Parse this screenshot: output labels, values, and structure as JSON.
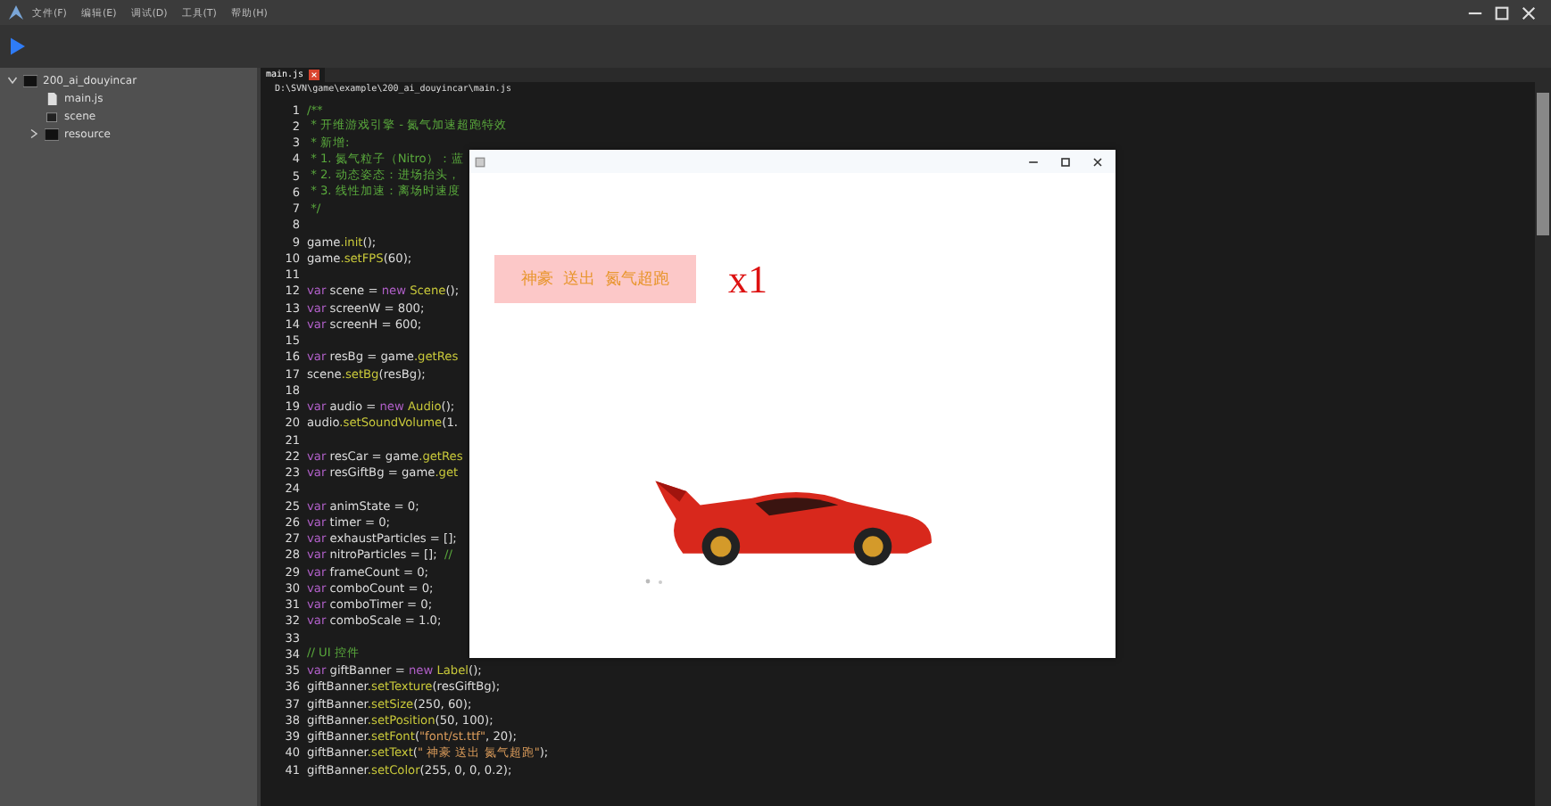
{
  "menu": [
    "文件(F)",
    "编辑(E)",
    "调试(D)",
    "工具(T)",
    "帮助(H)"
  ],
  "project_tree": [
    {
      "label": "200_ai_douyincar",
      "kind": "folder",
      "expanded": true,
      "children": [
        {
          "label": "main.js",
          "kind": "file"
        },
        {
          "label": "scene",
          "kind": "scene"
        },
        {
          "label": "resource",
          "kind": "folder",
          "expanded": false
        }
      ]
    }
  ],
  "editor": {
    "tab": {
      "label": "main.js",
      "selected": true
    },
    "path": "D:\\SVN\\game\\example\\200_ai_douyincar\\main.js",
    "lines": [
      {
        "number": "1",
        "text": "/**"
      },
      {
        "number": "2",
        "text": " * 开维游戏引擎 - 氮气加速超跑特效"
      },
      {
        "number": "3",
        "text": " * 新增:"
      },
      {
        "number": "4",
        "text": " * 1. 氮气粒子（Nitro）：蓝"
      },
      {
        "number": "5",
        "text": " * 2. 动态姿态：进场抬头，"
      },
      {
        "number": "6",
        "text": " * 3. 线性加速：离场时速度"
      },
      {
        "number": "7",
        "text": " */"
      },
      {
        "number": "8"
      },
      {
        "number": "9",
        "text": "game.init();"
      },
      {
        "number": "10",
        "text": "game.setFPS(60);"
      },
      {
        "number": "11"
      },
      {
        "number": "12",
        "text": "var scene = new Scene();"
      },
      {
        "number": "13",
        "text": "var screenW = 800;"
      },
      {
        "number": "14",
        "text": "var screenH = 600;"
      },
      {
        "number": "15"
      },
      {
        "number": "16",
        "text": "var resBg = game.getRes"
      },
      {
        "number": "17",
        "text": "scene.setBg(resBg);"
      },
      {
        "number": "18"
      },
      {
        "number": "19",
        "text": "var audio = new Audio();"
      },
      {
        "number": "20",
        "text": "audio.setSoundVolume(1."
      },
      {
        "number": "21"
      },
      {
        "number": "22",
        "text": "var resCar = game.getRes"
      },
      {
        "number": "23",
        "text": "var resGiftBg = game.get"
      },
      {
        "number": "24"
      },
      {
        "number": "25",
        "text": "var animState = 0;"
      },
      {
        "number": "26",
        "text": "var timer = 0;"
      },
      {
        "number": "27",
        "text": "var exhaustParticles = [];"
      },
      {
        "number": "28",
        "text": "var nitroParticles = [];  //"
      },
      {
        "number": "29",
        "text": "var frameCount = 0;"
      },
      {
        "number": "30",
        "text": "var comboCount = 0;"
      },
      {
        "number": "31",
        "text": "var comboTimer = 0;"
      },
      {
        "number": "32",
        "text": "var comboScale = 1.0;"
      },
      {
        "number": "33"
      },
      {
        "number": "34",
        "text": "// UI 控件"
      },
      {
        "number": "35",
        "text": "var giftBanner = new Label();"
      },
      {
        "number": "36",
        "text": "giftBanner.setTexture(resGiftBg);"
      },
      {
        "number": "37",
        "text": "giftBanner.setSize(250, 60);"
      },
      {
        "number": "38",
        "text": "giftBanner.setPosition(50, 100);"
      },
      {
        "number": "39",
        "text": "giftBanner.setFont(\"font/st.ttf\", 20);"
      },
      {
        "number": "40",
        "text": "giftBanner.setText(\" 神豪 送出 氮气超跑\");"
      },
      {
        "number": "41",
        "text": "giftBanner.setColor(255, 0, 0, 0.2);"
      }
    ]
  },
  "game_window": {
    "banner": "神豪  送出  氮气超跑",
    "combo": "x1"
  }
}
